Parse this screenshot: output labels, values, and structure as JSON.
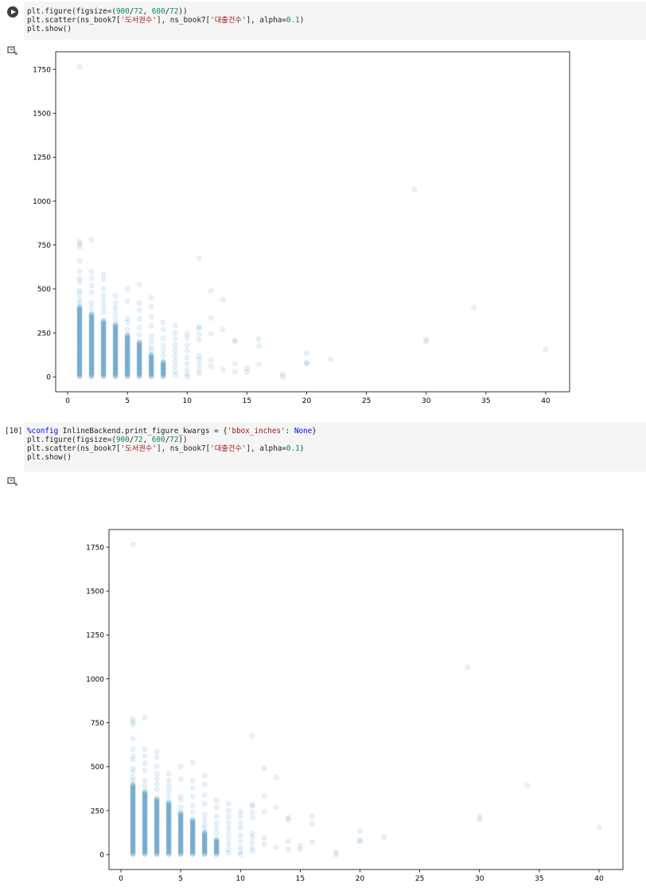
{
  "cell1": {
    "code_lines": [
      [
        {
          "t": "plt.figure(figsize=("
        },
        {
          "t": "900",
          "c": "num"
        },
        {
          "t": "/"
        },
        {
          "t": "72",
          "c": "num"
        },
        {
          "t": ", "
        },
        {
          "t": "600",
          "c": "num"
        },
        {
          "t": "/"
        },
        {
          "t": "72",
          "c": "num"
        },
        {
          "t": "))"
        }
      ],
      [
        {
          "t": "plt.scatter(ns_book7["
        },
        {
          "t": "'도서권수'",
          "c": "str"
        },
        {
          "t": "], ns_book7["
        },
        {
          "t": "'대출건수'",
          "c": "str"
        },
        {
          "t": "], alpha="
        },
        {
          "t": "0.1",
          "c": "num"
        },
        {
          "t": ")"
        }
      ],
      [
        {
          "t": "plt.show()"
        }
      ]
    ]
  },
  "cell2": {
    "exec_count": "[10]",
    "code_lines": [
      [
        {
          "t": "%config",
          "c": "mag"
        },
        {
          "t": " InlineBackend.print_figure_kwargs = {"
        },
        {
          "t": "'bbox_inches'",
          "c": "str"
        },
        {
          "t": ": "
        },
        {
          "t": "None",
          "c": "kw"
        },
        {
          "t": "}"
        }
      ],
      [
        {
          "t": "plt.figure(figsize=("
        },
        {
          "t": "900",
          "c": "num"
        },
        {
          "t": "/"
        },
        {
          "t": "72",
          "c": "num"
        },
        {
          "t": ", "
        },
        {
          "t": "600",
          "c": "num"
        },
        {
          "t": "/"
        },
        {
          "t": "72",
          "c": "num"
        },
        {
          "t": "))"
        }
      ],
      [
        {
          "t": "plt.scatter(ns_book7["
        },
        {
          "t": "'도서권수'",
          "c": "str"
        },
        {
          "t": "], ns_book7["
        },
        {
          "t": "'대출건수'",
          "c": "str"
        },
        {
          "t": "], alpha="
        },
        {
          "t": "0.1",
          "c": "num"
        },
        {
          "t": ")"
        }
      ],
      [
        {
          "t": "plt.show()"
        }
      ]
    ]
  },
  "colors": {
    "marker": "#1f77b4",
    "code_bg": "#f5f5f5"
  },
  "icons": {
    "run": "play-circle-icon",
    "output": "output-toggle-icon"
  },
  "chart_data": [
    {
      "type": "scatter",
      "title": "",
      "xlabel": "",
      "ylabel": "",
      "xlim": [
        -1,
        42
      ],
      "ylim": [
        -85,
        1850
      ],
      "xticks": [
        0,
        5,
        10,
        15,
        20,
        25,
        30,
        35,
        40
      ],
      "yticks": [
        0,
        250,
        500,
        750,
        1000,
        1250,
        1500,
        1750
      ],
      "alpha": 0.1,
      "grid": false,
      "dense_columns": [
        [
          1,
          400
        ],
        [
          2,
          360
        ],
        [
          3,
          320
        ],
        [
          4,
          300
        ],
        [
          5,
          240
        ],
        [
          6,
          200
        ],
        [
          7,
          130
        ],
        [
          8,
          90
        ]
      ],
      "points": [
        [
          1,
          1765
        ],
        [
          1,
          770
        ],
        [
          1,
          755
        ],
        [
          1,
          740
        ],
        [
          1,
          660
        ],
        [
          1,
          600
        ],
        [
          1,
          560
        ],
        [
          1,
          540
        ],
        [
          1,
          490
        ],
        [
          1,
          470
        ],
        [
          1,
          440
        ],
        [
          1,
          420
        ],
        [
          2,
          780
        ],
        [
          2,
          600
        ],
        [
          2,
          560
        ],
        [
          2,
          520
        ],
        [
          2,
          480
        ],
        [
          2,
          420
        ],
        [
          2,
          390
        ],
        [
          3,
          585
        ],
        [
          3,
          555
        ],
        [
          3,
          500
        ],
        [
          3,
          460
        ],
        [
          3,
          430
        ],
        [
          3,
          400
        ],
        [
          3,
          370
        ],
        [
          4,
          460
        ],
        [
          4,
          420
        ],
        [
          4,
          390
        ],
        [
          4,
          360
        ],
        [
          4,
          330
        ],
        [
          5,
          500
        ],
        [
          5,
          430
        ],
        [
          5,
          330
        ],
        [
          5,
          310
        ],
        [
          5,
          270
        ],
        [
          6,
          525
        ],
        [
          6,
          420
        ],
        [
          6,
          380
        ],
        [
          6,
          330
        ],
        [
          6,
          280
        ],
        [
          6,
          240
        ],
        [
          7,
          450
        ],
        [
          7,
          400
        ],
        [
          7,
          340
        ],
        [
          7,
          290
        ],
        [
          7,
          230
        ],
        [
          7,
          200
        ],
        [
          7,
          170
        ],
        [
          7,
          150
        ],
        [
          8,
          310
        ],
        [
          8,
          270
        ],
        [
          8,
          220
        ],
        [
          8,
          180
        ],
        [
          8,
          150
        ],
        [
          8,
          120
        ],
        [
          9,
          290
        ],
        [
          9,
          250
        ],
        [
          9,
          215
        ],
        [
          9,
          180
        ],
        [
          9,
          150
        ],
        [
          9,
          120
        ],
        [
          9,
          90
        ],
        [
          9,
          60
        ],
        [
          9,
          30
        ],
        [
          9,
          10
        ],
        [
          10,
          245
        ],
        [
          10,
          220
        ],
        [
          10,
          180
        ],
        [
          10,
          150
        ],
        [
          10,
          110
        ],
        [
          10,
          75
        ],
        [
          10,
          40
        ],
        [
          10,
          15
        ],
        [
          10,
          0
        ],
        [
          11,
          675
        ],
        [
          11,
          285
        ],
        [
          11,
          275
        ],
        [
          11,
          240
        ],
        [
          11,
          210
        ],
        [
          11,
          120
        ],
        [
          11,
          100
        ],
        [
          11,
          70
        ],
        [
          11,
          40
        ],
        [
          11,
          20
        ],
        [
          12,
          490
        ],
        [
          12,
          335
        ],
        [
          12,
          245
        ],
        [
          12,
          95
        ],
        [
          12,
          60
        ],
        [
          13,
          440
        ],
        [
          13,
          270
        ],
        [
          13,
          40
        ],
        [
          14,
          210
        ],
        [
          14,
          200
        ],
        [
          14,
          75
        ],
        [
          14,
          30
        ],
        [
          15,
          50
        ],
        [
          15,
          30
        ],
        [
          16,
          215
        ],
        [
          16,
          175
        ],
        [
          16,
          70
        ],
        [
          18,
          15
        ],
        [
          18,
          0
        ],
        [
          20,
          135
        ],
        [
          20,
          80
        ],
        [
          20,
          75
        ],
        [
          22,
          100
        ],
        [
          29,
          1065
        ],
        [
          30,
          215
        ],
        [
          30,
          200
        ],
        [
          34,
          395
        ],
        [
          40,
          155
        ]
      ]
    },
    {
      "type": "scatter",
      "title": "",
      "xlabel": "",
      "ylabel": "",
      "xlim": [
        -1,
        42
      ],
      "ylim": [
        -85,
        1850
      ],
      "xticks": [
        0,
        5,
        10,
        15,
        20,
        25,
        30,
        35,
        40
      ],
      "yticks": [
        0,
        250,
        500,
        750,
        1000,
        1250,
        1500,
        1750
      ],
      "alpha": 0.1,
      "grid": false,
      "same_data_as": 0
    }
  ]
}
